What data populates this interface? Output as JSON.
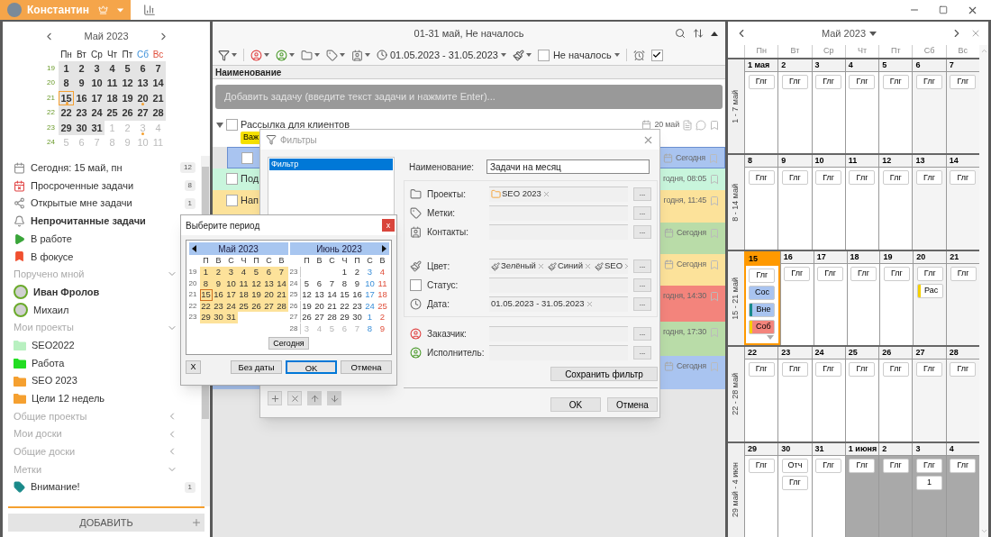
{
  "top_bar": {
    "user": "Константин"
  },
  "sidebar": {
    "calendar": {
      "title": "Май 2023",
      "weekdays": [
        {
          "label": "Пн",
          "kind": "day"
        },
        {
          "label": "Вт",
          "kind": "day"
        },
        {
          "label": "Ср",
          "kind": "day"
        },
        {
          "label": "Чт",
          "kind": "day"
        },
        {
          "label": "Пт",
          "kind": "day"
        },
        {
          "label": "Сб",
          "kind": "sat"
        },
        {
          "label": "Вс",
          "kind": "sun"
        }
      ],
      "weeks": [
        {
          "number": "19",
          "days": [
            {
              "label": "1",
              "in_month": true,
              "today": false,
              "dot": false
            },
            {
              "label": "2",
              "in_month": true,
              "today": false,
              "dot": false
            },
            {
              "label": "3",
              "in_month": true,
              "today": false,
              "dot": false
            },
            {
              "label": "4",
              "in_month": true,
              "today": false,
              "dot": false
            },
            {
              "label": "5",
              "in_month": true,
              "today": false,
              "dot": false
            },
            {
              "label": "6",
              "in_month": true,
              "today": false,
              "dot": false
            },
            {
              "label": "7",
              "in_month": true,
              "today": false,
              "dot": false
            }
          ]
        },
        {
          "number": "20",
          "days": [
            {
              "label": "8",
              "in_month": true,
              "today": false,
              "dot": false
            },
            {
              "label": "9",
              "in_month": true,
              "today": false,
              "dot": false
            },
            {
              "label": "10",
              "in_month": true,
              "today": false,
              "dot": false
            },
            {
              "label": "11",
              "in_month": true,
              "today": false,
              "dot": false
            },
            {
              "label": "12",
              "in_month": true,
              "today": false,
              "dot": false
            },
            {
              "label": "13",
              "in_month": true,
              "today": false,
              "dot": false
            },
            {
              "label": "14",
              "in_month": true,
              "today": false,
              "dot": false
            }
          ]
        },
        {
          "number": "21",
          "days": [
            {
              "label": "15",
              "in_month": true,
              "today": true,
              "dot": true
            },
            {
              "label": "16",
              "in_month": true,
              "today": false,
              "dot": false
            },
            {
              "label": "17",
              "in_month": true,
              "today": false,
              "dot": false
            },
            {
              "label": "18",
              "in_month": true,
              "today": false,
              "dot": false
            },
            {
              "label": "19",
              "in_month": true,
              "today": false,
              "dot": false
            },
            {
              "label": "20",
              "in_month": true,
              "today": false,
              "dot": true
            },
            {
              "label": "21",
              "in_month": true,
              "today": false,
              "dot": false
            }
          ]
        },
        {
          "number": "22",
          "days": [
            {
              "label": "22",
              "in_month": true,
              "today": false,
              "dot": false
            },
            {
              "label": "23",
              "in_month": true,
              "today": false,
              "dot": false
            },
            {
              "label": "24",
              "in_month": true,
              "today": false,
              "dot": false
            },
            {
              "label": "25",
              "in_month": true,
              "today": false,
              "dot": false
            },
            {
              "label": "26",
              "in_month": true,
              "today": false,
              "dot": false
            },
            {
              "label": "27",
              "in_month": true,
              "today": false,
              "dot": false
            },
            {
              "label": "28",
              "in_month": true,
              "today": false,
              "dot": false
            }
          ]
        },
        {
          "number": "23",
          "days": [
            {
              "label": "29",
              "in_month": true,
              "today": false,
              "dot": false
            },
            {
              "label": "30",
              "in_month": true,
              "today": false,
              "dot": false
            },
            {
              "label": "31",
              "in_month": true,
              "today": false,
              "dot": false
            },
            {
              "label": "1",
              "in_month": false,
              "today": false,
              "dot": false
            },
            {
              "label": "2",
              "in_month": false,
              "today": false,
              "dot": false
            },
            {
              "label": "3",
              "in_month": false,
              "today": false,
              "dot": true
            },
            {
              "label": "4",
              "in_month": false,
              "today": false,
              "dot": false
            }
          ]
        },
        {
          "number": "24",
          "days": [
            {
              "label": "5",
              "in_month": false,
              "today": false,
              "dot": false
            },
            {
              "label": "6",
              "in_month": false,
              "today": false,
              "dot": false
            },
            {
              "label": "7",
              "in_month": false,
              "today": false,
              "dot": false
            },
            {
              "label": "8",
              "in_month": false,
              "today": false,
              "dot": false
            },
            {
              "label": "9",
              "in_month": false,
              "today": false,
              "dot": false
            },
            {
              "label": "10",
              "in_month": false,
              "today": false,
              "dot": false
            },
            {
              "label": "11",
              "in_month": false,
              "today": false,
              "dot": false
            }
          ]
        }
      ]
    },
    "items": [
      {
        "kind": "today",
        "label": "Сегодня: 15 май, пн",
        "count": "12",
        "bold": false
      },
      {
        "kind": "overdue",
        "label": "Просроченные задачи",
        "count": "8",
        "bold": false
      },
      {
        "kind": "shared",
        "label": "Открытые мне задачи",
        "count": "1",
        "bold": false
      },
      {
        "kind": "unread",
        "label": "Непрочитанные задачи",
        "bold": true
      },
      {
        "kind": "in_work",
        "label": "В работе",
        "bold": false
      },
      {
        "kind": "focus",
        "label": "В фокусе",
        "bold": false
      },
      {
        "kind": "section",
        "label": "Поручено мной",
        "expanded": true
      },
      {
        "kind": "person",
        "label": "Иван Фролов",
        "bold": true
      },
      {
        "kind": "person",
        "label": "Михаил",
        "bold": false
      },
      {
        "kind": "section",
        "label": "Мои проекты",
        "expanded": true
      },
      {
        "kind": "project",
        "label": "SEO2022",
        "color": "#b8f0c0",
        "bold": false
      },
      {
        "kind": "project",
        "label": "Работа",
        "color": "#22dd22",
        "bold": false
      },
      {
        "kind": "project",
        "label": "SEO 2023",
        "color": "#f5a030",
        "bold": false
      },
      {
        "kind": "project",
        "label": "Цели 12 недель",
        "color": "#f5a030",
        "bold": false
      },
      {
        "kind": "section",
        "label": "Общие проекты",
        "expanded": false
      },
      {
        "kind": "section",
        "label": "Мои доски",
        "expanded": false
      },
      {
        "kind": "section",
        "label": "Общие доски",
        "expanded": false
      },
      {
        "kind": "section",
        "label": "Метки",
        "expanded": true
      },
      {
        "kind": "tag",
        "label": "Внимание!",
        "count": "1",
        "color": "#1a8a8a",
        "bold": false
      }
    ],
    "add_button": "ДОБАВИТЬ"
  },
  "task_list": {
    "title": "01-31 май, Не началось",
    "toolbar": {
      "date_range": "01.05.2023 - 31.05.2023",
      "status": {
        "label": "Не началось",
        "checked": false
      },
      "done_filter": {
        "checked": true
      }
    },
    "column": "Наименование",
    "add_placeholder": "Добавить задачу (введите текст задачи и нажмите Enter)...",
    "tasks": [
      {
        "title": "Рассылка для клиентов",
        "tag": "Важ",
        "due": "20 май",
        "calendar_icon": true,
        "color": "#ffffff",
        "checked": false,
        "selected": false,
        "expanded": true,
        "children": [
          {
            "due": "Сегодня",
            "calendar_icon": true,
            "color": "#a9c4f0",
            "checked": false,
            "selected": true
          }
        ]
      },
      {
        "title": "Под",
        "due": "годня, 08:05",
        "calendar_icon": false,
        "color": "#c8f5dc",
        "checked": false,
        "selected": false
      },
      {
        "title": "Нап",
        "due": "годня, 11:45",
        "calendar_icon": false,
        "color": "#fce29a",
        "checked": false,
        "selected": false
      },
      {
        "due": "Сегодня",
        "calendar_icon": true,
        "color": "#b9dca8",
        "selected": false
      },
      {
        "due": "Сегодня",
        "calendar_icon": true,
        "color": "#fce29a",
        "selected": false
      },
      {
        "due": "годня, 14:30",
        "calendar_icon": false,
        "color": "#f3847c",
        "selected": false
      },
      {
        "due": "годня, 17:30",
        "calendar_icon": false,
        "color": "#b9dca8",
        "selected": false
      },
      {
        "due": "Сегодня",
        "calendar_icon": true,
        "color": "#a9c4f0",
        "selected": false
      }
    ]
  },
  "month_view": {
    "title": "Май 2023",
    "weekdays": [
      "Пн",
      "Вт",
      "Ср",
      "Чт",
      "Пт",
      "Сб",
      "Вс"
    ],
    "weeks": [
      {
        "label": "1 - 7 май",
        "days": [
          {
            "date": "1 мая",
            "kind": "day",
            "today": false,
            "chips": [
              {
                "text": "Глг",
                "color": "#ffffff"
              }
            ]
          },
          {
            "date": "2",
            "kind": "day",
            "today": false,
            "chips": [
              {
                "text": "Глг",
                "color": "#ffffff"
              }
            ]
          },
          {
            "date": "3",
            "kind": "day",
            "today": false,
            "chips": [
              {
                "text": "Глг",
                "color": "#ffffff"
              }
            ]
          },
          {
            "date": "4",
            "kind": "day",
            "today": false,
            "chips": [
              {
                "text": "Глг",
                "color": "#ffffff"
              }
            ]
          },
          {
            "date": "5",
            "kind": "day",
            "today": false,
            "chips": [
              {
                "text": "Глг",
                "color": "#ffffff"
              }
            ]
          },
          {
            "date": "6",
            "kind": "weekend",
            "today": false,
            "chips": [
              {
                "text": "Глг",
                "color": "#ffffff"
              }
            ]
          },
          {
            "date": "7",
            "kind": "weekend",
            "today": false,
            "chips": [
              {
                "text": "Глг",
                "color": "#ffffff"
              }
            ]
          }
        ]
      },
      {
        "label": "8 - 14 май",
        "days": [
          {
            "date": "8",
            "kind": "day",
            "today": false,
            "chips": [
              {
                "text": "Глг",
                "color": "#ffffff"
              }
            ]
          },
          {
            "date": "9",
            "kind": "day",
            "today": false,
            "chips": [
              {
                "text": "Глг",
                "color": "#ffffff"
              }
            ]
          },
          {
            "date": "10",
            "kind": "day",
            "today": false,
            "chips": [
              {
                "text": "Глг",
                "color": "#ffffff"
              }
            ]
          },
          {
            "date": "11",
            "kind": "day",
            "today": false,
            "chips": [
              {
                "text": "Глг",
                "color": "#ffffff"
              }
            ]
          },
          {
            "date": "12",
            "kind": "day",
            "today": false,
            "chips": [
              {
                "text": "Глг",
                "color": "#ffffff"
              }
            ]
          },
          {
            "date": "13",
            "kind": "weekend",
            "today": false,
            "chips": [
              {
                "text": "Глг",
                "color": "#ffffff"
              }
            ]
          },
          {
            "date": "14",
            "kind": "weekend",
            "today": false,
            "chips": [
              {
                "text": "Глг",
                "color": "#ffffff"
              }
            ]
          }
        ]
      },
      {
        "label": "15 - 21 май",
        "days": [
          {
            "date": "15",
            "kind": "day",
            "today": true,
            "more": true,
            "chips": [
              {
                "text": "Глг",
                "color": "#ffffff"
              },
              {
                "text": "Сос",
                "color": "#a9c4f0"
              },
              {
                "text": "Вне",
                "color": "#a9c4f0",
                "stripe": {
                  "color": "#1a8a8a"
                }
              },
              {
                "text": "Соб",
                "color": "#f3847c",
                "stripe": {
                  "color": "#f5d000"
                }
              }
            ]
          },
          {
            "date": "16",
            "kind": "day",
            "today": false,
            "chips": [
              {
                "text": "Глг",
                "color": "#ffffff"
              }
            ]
          },
          {
            "date": "17",
            "kind": "day",
            "today": false,
            "chips": [
              {
                "text": "Глг",
                "color": "#ffffff"
              }
            ]
          },
          {
            "date": "18",
            "kind": "day",
            "today": false,
            "chips": [
              {
                "text": "Глг",
                "color": "#ffffff"
              }
            ]
          },
          {
            "date": "19",
            "kind": "day",
            "today": false,
            "chips": [
              {
                "text": "Глг",
                "color": "#ffffff"
              }
            ]
          },
          {
            "date": "20",
            "kind": "weekend",
            "today": false,
            "chips": [
              {
                "text": "Глг",
                "color": "#ffffff"
              },
              {
                "text": "Рас",
                "color": "#ffffff",
                "stripe": {
                  "color": "#f5d000"
                }
              }
            ]
          },
          {
            "date": "21",
            "kind": "weekend",
            "today": false,
            "chips": [
              {
                "text": "Глг",
                "color": "#ffffff"
              }
            ]
          }
        ]
      },
      {
        "label": "22 - 28 май",
        "days": [
          {
            "date": "22",
            "kind": "day",
            "today": false,
            "chips": [
              {
                "text": "Глг",
                "color": "#ffffff"
              }
            ]
          },
          {
            "date": "23",
            "kind": "day",
            "today": false,
            "chips": [
              {
                "text": "Глг",
                "color": "#ffffff"
              }
            ]
          },
          {
            "date": "24",
            "kind": "day",
            "today": false,
            "chips": [
              {
                "text": "Глг",
                "color": "#ffffff"
              }
            ]
          },
          {
            "date": "25",
            "kind": "day",
            "today": false,
            "chips": [
              {
                "text": "Глг",
                "color": "#ffffff"
              }
            ]
          },
          {
            "date": "26",
            "kind": "day",
            "today": false,
            "chips": [
              {
                "text": "Глг",
                "color": "#ffffff"
              }
            ]
          },
          {
            "date": "27",
            "kind": "weekend",
            "today": false,
            "chips": [
              {
                "text": "Глг",
                "color": "#ffffff"
              }
            ]
          },
          {
            "date": "28",
            "kind": "weekend",
            "today": false,
            "chips": [
              {
                "text": "Глг",
                "color": "#ffffff"
              }
            ]
          }
        ]
      },
      {
        "label": "29 май - 4 июн",
        "days": [
          {
            "date": "29",
            "kind": "day",
            "today": false,
            "chips": [
              {
                "text": "Глг",
                "color": "#ffffff"
              }
            ]
          },
          {
            "date": "30",
            "kind": "day",
            "today": false,
            "chips": [
              {
                "text": "Отч",
                "color": "#ffffff"
              },
              {
                "text": "Глг",
                "color": "#ffffff"
              }
            ]
          },
          {
            "date": "31",
            "kind": "day",
            "today": false,
            "chips": [
              {
                "text": "Глг",
                "color": "#ffffff"
              }
            ]
          },
          {
            "date": "1 июня",
            "kind": "next",
            "today": false,
            "chips": [
              {
                "text": "Глг",
                "color": "#ffffff"
              }
            ]
          },
          {
            "date": "2",
            "kind": "next",
            "today": false,
            "chips": [
              {
                "text": "Глг",
                "color": "#ffffff"
              }
            ]
          },
          {
            "date": "3",
            "kind": "next",
            "today": false,
            "chips": [
              {
                "text": "Глг",
                "color": "#ffffff"
              },
              {
                "text": "1",
                "color": "#ffffff"
              }
            ]
          },
          {
            "date": "4",
            "kind": "next",
            "today": false,
            "chips": [
              {
                "text": "Глг",
                "color": "#ffffff"
              }
            ]
          }
        ]
      }
    ]
  },
  "filter_dialog": {
    "title": "Фильтры",
    "filters": [
      {
        "label": "Фильтр",
        "selected": true
      }
    ],
    "name_label": "Наименование:",
    "name_value": "Задачи на месяц",
    "box_sections": [
      [
        {
          "kind": "projects",
          "label": "Проекты:",
          "chips": [
            {
              "label": "SEO 2023"
            }
          ]
        },
        {
          "kind": "tags",
          "label": "Метки:"
        },
        {
          "kind": "contacts",
          "label": "Контакты:"
        }
      ],
      [
        {
          "kind": "color",
          "label": "Цвет:",
          "chips": [
            {
              "label": "Зелёный"
            },
            {
              "label": "Синий"
            },
            {
              "label": "SEO"
            }
          ]
        },
        {
          "kind": "status",
          "label": "Статус:",
          "checked": false
        },
        {
          "kind": "date",
          "label": "Дата:",
          "chips": [
            {
              "label": "01.05.2023 - 31.05.2023"
            }
          ]
        }
      ]
    ],
    "person_fields": [
      {
        "kind": "customer",
        "label": "Заказчик:"
      },
      {
        "kind": "performer",
        "label": "Исполнитель:"
      }
    ],
    "browse_button": "...",
    "save_button": "Сохранить фильтр",
    "ok_button": "OK",
    "cancel_button": "Отмена"
  },
  "period_dialog": {
    "title": "Выберите период",
    "close": "x",
    "months": [
      {
        "title": "Май 2023",
        "prev_arrow": true,
        "next_arrow": false,
        "weekdays": [
          "П",
          "В",
          "С",
          "Ч",
          "П",
          "С",
          "В"
        ],
        "weeks": [
          {
            "number": "19",
            "days": [
              {
                "label": "1",
                "selected": true,
                "today": false
              },
              {
                "label": "2",
                "selected": true,
                "today": false
              },
              {
                "label": "3",
                "selected": true,
                "today": false
              },
              {
                "label": "4",
                "selected": true,
                "today": false
              },
              {
                "label": "5",
                "selected": true,
                "today": false
              },
              {
                "label": "6",
                "selected": true,
                "today": false
              },
              {
                "label": "7",
                "selected": true,
                "today": false
              }
            ]
          },
          {
            "number": "20",
            "days": [
              {
                "label": "8",
                "selected": true,
                "today": false
              },
              {
                "label": "9",
                "selected": true,
                "today": false
              },
              {
                "label": "10",
                "selected": true,
                "today": false
              },
              {
                "label": "11",
                "selected": true,
                "today": false
              },
              {
                "label": "12",
                "selected": true,
                "today": false
              },
              {
                "label": "13",
                "selected": true,
                "today": false
              },
              {
                "label": "14",
                "selected": true,
                "today": false
              }
            ]
          },
          {
            "number": "21",
            "days": [
              {
                "label": "15",
                "selected": true,
                "today": true
              },
              {
                "label": "16",
                "selected": true,
                "today": false
              },
              {
                "label": "17",
                "selected": true,
                "today": false
              },
              {
                "label": "18",
                "selected": true,
                "today": false
              },
              {
                "label": "19",
                "selected": true,
                "today": false
              },
              {
                "label": "20",
                "selected": true,
                "today": false
              },
              {
                "label": "21",
                "selected": true,
                "today": false
              }
            ]
          },
          {
            "number": "22",
            "days": [
              {
                "label": "22",
                "selected": true,
                "today": false
              },
              {
                "label": "23",
                "selected": true,
                "today": false
              },
              {
                "label": "24",
                "selected": true,
                "today": false
              },
              {
                "label": "25",
                "selected": true,
                "today": false
              },
              {
                "label": "26",
                "selected": true,
                "today": false
              },
              {
                "label": "27",
                "selected": true,
                "today": false
              },
              {
                "label": "28",
                "selected": true,
                "today": false
              }
            ]
          },
          {
            "number": "23",
            "days": [
              {
                "label": "29",
                "selected": true,
                "today": false
              },
              {
                "label": "30",
                "selected": true,
                "today": false
              },
              {
                "label": "31",
                "selected": true,
                "today": false
              }
            ]
          }
        ]
      },
      {
        "title": "Июнь 2023",
        "prev_arrow": false,
        "next_arrow": true,
        "weekdays": [
          "П",
          "В",
          "С",
          "Ч",
          "П",
          "С",
          "В"
        ],
        "weeks": [
          {
            "number": "23",
            "days": [
              {
                "label": "1",
                "kind": "day"
              },
              {
                "label": "2",
                "kind": "day"
              },
              {
                "label": "3",
                "kind": "sat"
              },
              {
                "label": "4",
                "kind": "sun"
              }
            ]
          },
          {
            "number": "24",
            "days": [
              {
                "label": "5",
                "kind": "day"
              },
              {
                "label": "6",
                "kind": "day"
              },
              {
                "label": "7",
                "kind": "day"
              },
              {
                "label": "8",
                "kind": "day"
              },
              {
                "label": "9",
                "kind": "day"
              },
              {
                "label": "10",
                "kind": "sat"
              },
              {
                "label": "11",
                "kind": "sun"
              }
            ]
          },
          {
            "number": "25",
            "days": [
              {
                "label": "12",
                "kind": "day"
              },
              {
                "label": "13",
                "kind": "day"
              },
              {
                "label": "14",
                "kind": "day"
              },
              {
                "label": "15",
                "kind": "day"
              },
              {
                "label": "16",
                "kind": "day"
              },
              {
                "label": "17",
                "kind": "sat"
              },
              {
                "label": "18",
                "kind": "sun"
              }
            ]
          },
          {
            "number": "26",
            "days": [
              {
                "label": "19",
                "kind": "day"
              },
              {
                "label": "20",
                "kind": "day"
              },
              {
                "label": "21",
                "kind": "day"
              },
              {
                "label": "22",
                "kind": "day"
              },
              {
                "label": "23",
                "kind": "day"
              },
              {
                "label": "24",
                "kind": "sat"
              },
              {
                "label": "25",
                "kind": "sun"
              }
            ]
          },
          {
            "number": "27",
            "days": [
              {
                "label": "26",
                "kind": "day"
              },
              {
                "label": "27",
                "kind": "day"
              },
              {
                "label": "28",
                "kind": "day"
              },
              {
                "label": "29",
                "kind": "day"
              },
              {
                "label": "30",
                "kind": "day"
              },
              {
                "label": "1",
                "kind": "sat"
              },
              {
                "label": "2",
                "kind": "sun"
              }
            ]
          },
          {
            "number": "28",
            "days": [
              {
                "label": "3",
                "kind": "next"
              },
              {
                "label": "4",
                "kind": "next"
              },
              {
                "label": "5",
                "kind": "next"
              },
              {
                "label": "6",
                "kind": "next"
              },
              {
                "label": "7",
                "kind": "next"
              },
              {
                "label": "8",
                "kind": "sat"
              },
              {
                "label": "9",
                "kind": "sun"
              }
            ]
          }
        ]
      }
    ],
    "today_button": "Сегодня",
    "clear_button": "X",
    "buttons": [
      {
        "label": "Без даты",
        "focused": false
      },
      {
        "label": "OK",
        "focused": true
      },
      {
        "label": "Отмена",
        "focused": false
      }
    ]
  }
}
